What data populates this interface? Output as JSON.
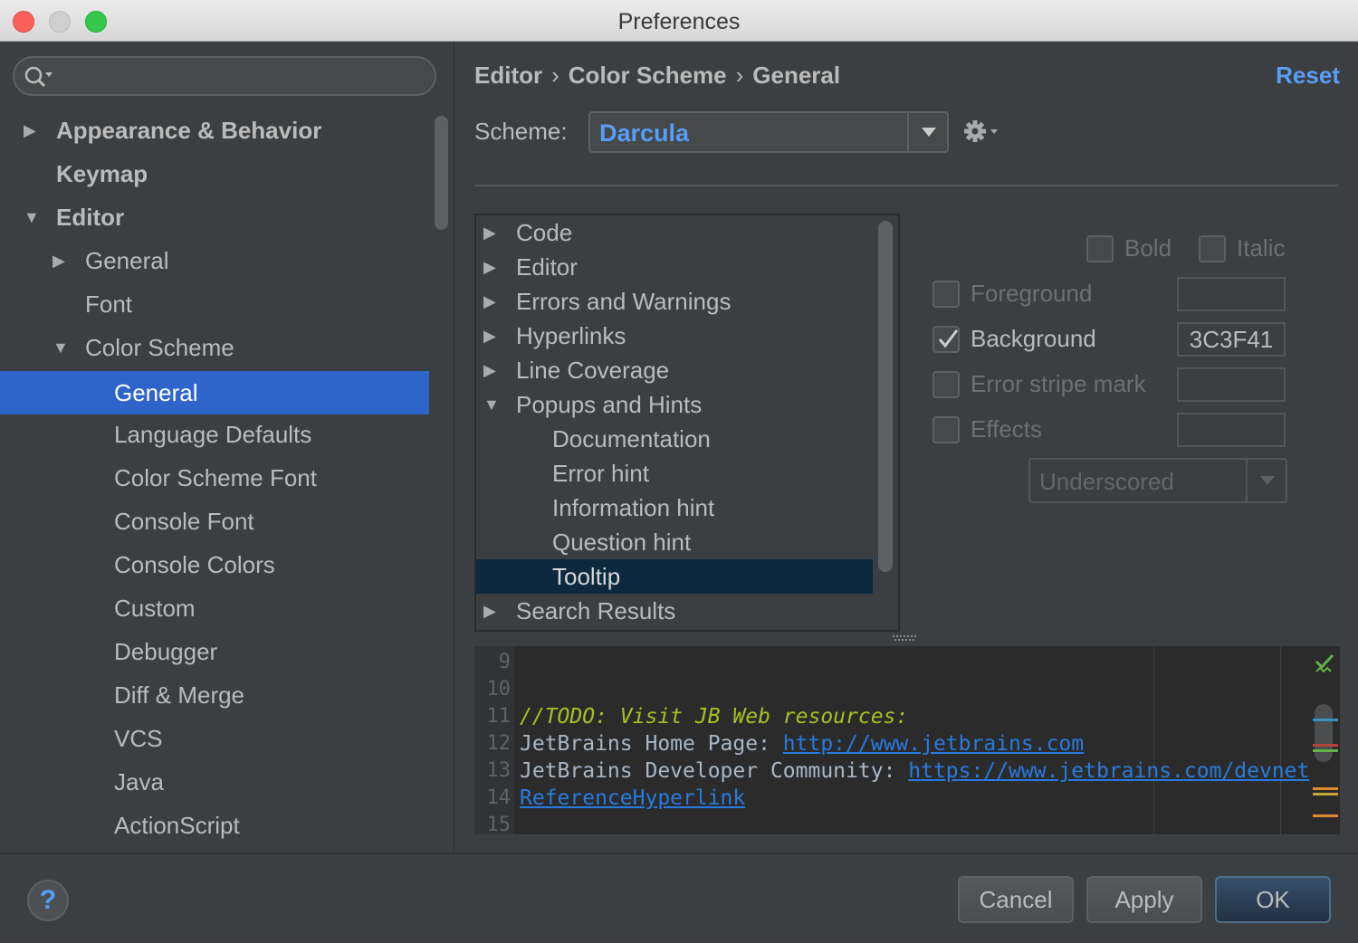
{
  "window": {
    "title": "Preferences"
  },
  "sidebar": {
    "search_placeholder": "",
    "items": [
      {
        "label": "Appearance & Behavior",
        "arrow": "▶"
      },
      {
        "label": "Keymap"
      },
      {
        "label": "Editor",
        "arrow": "▼"
      },
      {
        "label": "General",
        "arrow": "▶"
      },
      {
        "label": "Font"
      },
      {
        "label": "Color Scheme",
        "arrow": "▼"
      },
      {
        "label": "General",
        "selected": true
      },
      {
        "label": "Language Defaults"
      },
      {
        "label": "Color Scheme Font"
      },
      {
        "label": "Console Font"
      },
      {
        "label": "Console Colors"
      },
      {
        "label": "Custom"
      },
      {
        "label": "Debugger"
      },
      {
        "label": "Diff & Merge"
      },
      {
        "label": "VCS"
      },
      {
        "label": "Java"
      },
      {
        "label": "ActionScript"
      }
    ]
  },
  "header": {
    "breadcrumbs": [
      "Editor",
      "Color Scheme",
      "General"
    ],
    "separator": "›",
    "reset_label": "Reset"
  },
  "scheme": {
    "label": "Scheme:",
    "value": "Darcula"
  },
  "categories": [
    {
      "label": "Code",
      "arrow": "▶"
    },
    {
      "label": "Editor",
      "arrow": "▶"
    },
    {
      "label": "Errors and Warnings",
      "arrow": "▶"
    },
    {
      "label": "Hyperlinks",
      "arrow": "▶"
    },
    {
      "label": "Line Coverage",
      "arrow": "▶"
    },
    {
      "label": "Popups and Hints",
      "arrow": "▼"
    },
    {
      "label": "Documentation"
    },
    {
      "label": "Error hint"
    },
    {
      "label": "Information hint"
    },
    {
      "label": "Question hint"
    },
    {
      "label": "Tooltip",
      "selected": true
    },
    {
      "label": "Search Results",
      "arrow": "▶"
    }
  ],
  "attributes": {
    "bold_label": "Bold",
    "italic_label": "Italic",
    "foreground_label": "Foreground",
    "foreground_value": "",
    "background_label": "Background",
    "background_value": "3C3F41",
    "background_checked": true,
    "error_stripe_label": "Error stripe mark",
    "error_stripe_value": "",
    "effects_label": "Effects",
    "effects_value": "",
    "effects_type": "Underscored"
  },
  "preview": {
    "lines": [
      {
        "n": "9",
        "text": ""
      },
      {
        "n": "10",
        "text": ""
      },
      {
        "n": "11",
        "todo": "//TODO: Visit JB Web resources:"
      },
      {
        "n": "12",
        "text": "JetBrains Home Page: ",
        "link": "http://www.jetbrains.com"
      },
      {
        "n": "13",
        "text": "JetBrains Developer Community: ",
        "link": "https://www.jetbrains.com/devnet"
      },
      {
        "n": "14",
        "link": "ReferenceHyperlink"
      },
      {
        "n": "15",
        "text": ""
      }
    ]
  },
  "footer": {
    "help_label": "?",
    "cancel_label": "Cancel",
    "apply_label": "Apply",
    "ok_label": "OK"
  },
  "colors": {
    "accent": "#589df6",
    "selection": "#2f65ca",
    "todo": "#a8c023",
    "link": "#287bde"
  }
}
